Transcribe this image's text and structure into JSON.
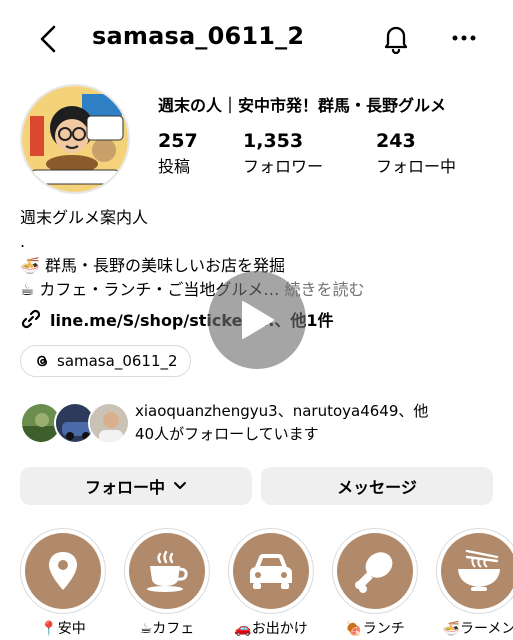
{
  "header": {
    "username": "samasa_0611_2"
  },
  "profile": {
    "name": "週末の人｜安中市発！群馬・長野グルメ",
    "stats": [
      {
        "value": "257",
        "label": "投稿"
      },
      {
        "value": "1,353",
        "label": "フォロワー"
      },
      {
        "value": "243",
        "label": "フォロー中"
      }
    ]
  },
  "bio": {
    "line1": "週末グルメ案内人",
    "line2": ".",
    "line3": "🍜 群馬・長野の美味しいお店を発掘",
    "line4": "☕ カフェ・ランチ・ご当地グルメ…",
    "more": "続きを読む",
    "link": "line.me/S/shop/sticker/...、他1件"
  },
  "threads": {
    "handle": "samasa_0611_2"
  },
  "followed_by": {
    "line1": "xiaoquanzhengyu3、narutoya4649、他",
    "line2": "40人がフォローしています"
  },
  "buttons": {
    "following": "フォロー中",
    "message": "メッセージ"
  },
  "highlights": [
    {
      "label": "📍安中",
      "icon": "location-pin-icon"
    },
    {
      "label": "☕カフェ",
      "icon": "coffee-cup-icon"
    },
    {
      "label": "🚗お出かけ",
      "icon": "car-icon"
    },
    {
      "label": "🍖ランチ",
      "icon": "drumstick-icon"
    },
    {
      "label": "🍜ラーメン",
      "icon": "ramen-bowl-icon"
    }
  ],
  "colors": {
    "highlight_bg": "#b08a6a",
    "button_bg": "#efefef",
    "muted_text": "#737373"
  }
}
